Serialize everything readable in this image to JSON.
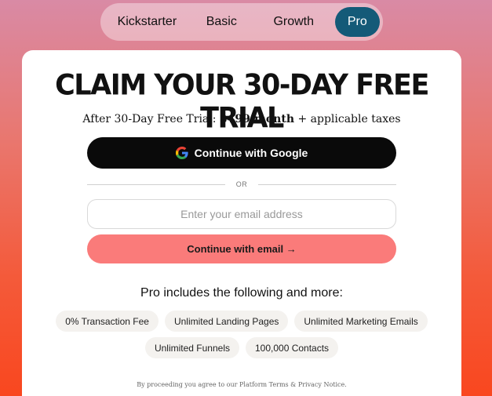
{
  "plan_tabs": [
    {
      "label": "Kickstarter",
      "selected": false
    },
    {
      "label": "Basic",
      "selected": false
    },
    {
      "label": "Growth",
      "selected": false
    },
    {
      "label": "Pro",
      "selected": true
    }
  ],
  "card": {
    "headline": "CLAIM YOUR 30-DAY FREE TRIAL",
    "subline_prefix": "After 30-Day Free Trial: ",
    "subline_price": "$499/month",
    "subline_suffix": " + applicable taxes",
    "google_button_label": "Continue with Google",
    "google_icon": "google-g-icon",
    "or_text": "OR",
    "email_placeholder": "Enter your email address",
    "email_value": "",
    "email_button_label": "Continue with email →",
    "includes_heading": "Pro includes the following and more:",
    "features_row1": [
      "0% Transaction Fee",
      "Unlimited Landing Pages",
      "Unlimited Marketing Emails"
    ],
    "features_row2": [
      "Unlimited Funnels",
      "100,000 Contacts"
    ],
    "legal_text": "By proceeding you agree to our Platform Terms & Privacy Notice."
  },
  "colors": {
    "selected_tab": "#145a78",
    "primary_button": "#0a0a0a",
    "email_button": "#fa7b7a",
    "background_top": "#d98aa5",
    "background_bottom": "#f9471f"
  }
}
